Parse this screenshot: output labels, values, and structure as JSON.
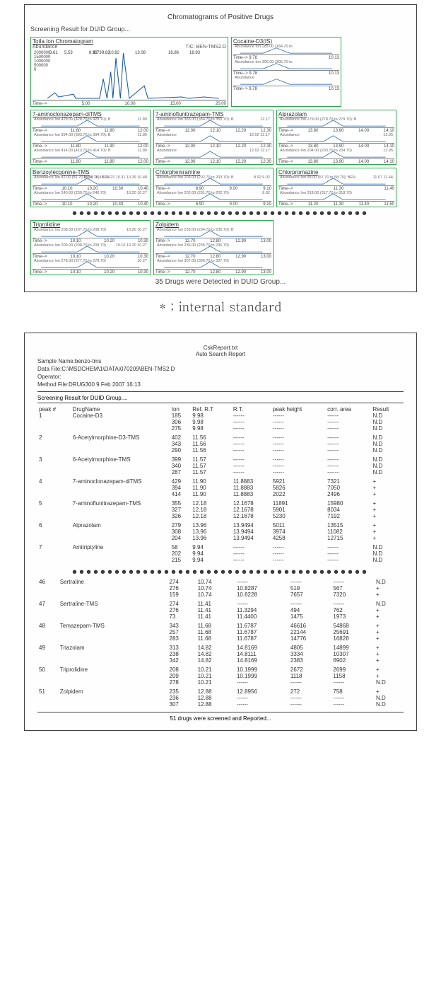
{
  "fig1": {
    "title": "Chromatograms of Positive Drugs",
    "subtitle": "Screening Result for DUID Group...",
    "tic": {
      "title": "Totla Ion Chromatogram",
      "trace_label": "TIC: BEN-TMS2.D",
      "ylab": "Abundance",
      "y_ticks": [
        "2000000",
        "1500000",
        "1000000",
        "500000",
        "0"
      ],
      "peak_labels": [
        "3.61",
        "5.53",
        "8.93",
        "9.73",
        "9.82",
        "10.82",
        "13.08",
        "16.86",
        "18.93"
      ],
      "x_ticks": [
        "5.00",
        "10.00",
        "15.00",
        "20.00"
      ],
      "timelab": "Time-->"
    },
    "is_panel": {
      "title": "Cocaine-D3(IS)",
      "rows": [
        {
          "label": "Abundance Ion 185.00 (184.70 to",
          "left": "9.78",
          "right": "10.13"
        },
        {
          "label": "Abundance Ion 306.00 (305.70 to",
          "left": "9.78",
          "right": "10.13"
        },
        {
          "label": "Abundance",
          "left": "9.78",
          "right": "10.13"
        }
      ],
      "timelab": "Time-->"
    },
    "compounds_row2": [
      {
        "title": "7-aminoclonazepam-diTMS",
        "rows": [
          {
            "label": "Abundance Ion 429.00 (428.70 to 429.70): B",
            "peak": "11.89",
            "ticks": [
              "11.80",
              "11.90",
              "12.00"
            ]
          },
          {
            "label": "Abundance Ion 394.00 (393.70 to 394.70): B",
            "peak": "11.89",
            "ticks": [
              "11.80",
              "11.90",
              "12.00"
            ]
          },
          {
            "label": "Abundance Ion 414.00 (413.70 to 414.70): B",
            "peak": "11.89",
            "ticks": [
              "11.80",
              "11.90",
              "12.00"
            ]
          }
        ]
      },
      {
        "title": "7-aminoflunitrazepam-TMS",
        "rows": [
          {
            "label": "Abundance Ion 355.00 (354.70 to 355.70): B",
            "peak": "12.17",
            "ticks": [
              "12.00",
              "12.10",
              "12.20",
              "12.30"
            ]
          },
          {
            "label": "Abundance",
            "peak": "12.02   12.17",
            "ticks": [
              "12.00",
              "12.10",
              "12.20",
              "12.30"
            ]
          },
          {
            "label": "Abundance",
            "peak": "12.02   12.17",
            "ticks": [
              "12.00",
              "12.10",
              "12.20",
              "12.30"
            ]
          }
        ]
      },
      {
        "title": "Alprazolam",
        "rows": [
          {
            "label": "Abundance Ion 279.00 (278.70 to 279.70): B",
            "peak": "",
            "ticks": [
              "13.80",
              "13.90",
              "14.00",
              "14.10"
            ]
          },
          {
            "label": "Abundance",
            "peak": "13.95",
            "ticks": [
              "13.80",
              "13.90",
              "14.00",
              "14.10"
            ]
          },
          {
            "label": "Abundance Ion 204.00 (203.70 to 204.70)",
            "peak": "13.95",
            "ticks": [
              "13.80",
              "13.90",
              "14.00",
              "14.10"
            ]
          }
        ]
      }
    ],
    "compounds_row3": [
      {
        "title": "Benzoylecgonine-TMS",
        "rows": [
          {
            "label": "Abundance Ion 82.00 (81.70 to 82.70): BEN",
            "peak": "10.08 10.17 10.23 10.31 10.39 10.48",
            "ticks": [
              "10.10",
              "10.20",
              "10.30",
              "10.40"
            ]
          },
          {
            "label": "Abundance Ion 240.00 (239.70 to 240.70)",
            "peak": "10.20 10.27",
            "ticks": [
              "10.10",
              "10.20",
              "10.30",
              "10.40"
            ]
          }
        ]
      },
      {
        "title": "Chlorpheniramine",
        "rows": [
          {
            "label": "Abundance Ion 203.00 (202.70 to 203.70): B",
            "peak": "8.92   9.02",
            "ticks": [
              "8.90",
              "9.00",
              "9.10"
            ]
          },
          {
            "label": "Abundance Ion 202.00 (201.70 to 202.70)",
            "peak": "8.92",
            "ticks": [
              "8.90",
              "9.00",
              "9.10"
            ]
          }
        ]
      },
      {
        "title": "Chlorpromazine",
        "rows": [
          {
            "label": "Abundance Ion 58.00 (57.70 to 58.70): BEN",
            "peak": "11.07   11.44",
            "ticks": [
              "11.30",
              "11.40"
            ]
          },
          {
            "label": "Abundance Ion 318.00 (317.70 to 318.70)",
            "peak": "",
            "ticks": [
              "11.20",
              "11.30",
              "11.40",
              "11.50"
            ]
          }
        ]
      }
    ],
    "compounds_row4": [
      {
        "title": "Triprolidine",
        "rows": [
          {
            "label": "Abundance Ion 208.00 (207.70 to 208.70)",
            "peak": "10.20 10.27",
            "ticks": [
              "10.10",
              "10.20",
              "10.30"
            ]
          },
          {
            "label": "Abundance Ion 209.00 (208.70 to 209.70)",
            "peak": "10.10 10.20 10.27",
            "ticks": [
              "10.10",
              "10.20",
              "10.30"
            ]
          },
          {
            "label": "Abundance Ion 278.00 (277.70 to 278.70)",
            "peak": "10.27",
            "ticks": [
              "10.10",
              "10.20",
              "10.30"
            ]
          }
        ]
      },
      {
        "title": "Zolpidem",
        "rows": [
          {
            "label": "Abundance Ion 235.00 (234.70 to 235.70): B",
            "peak": "",
            "ticks": [
              "12.70",
              "12.80",
              "12.90",
              "13.00"
            ]
          },
          {
            "label": "Abundance Ion 236.00 (235.70 to 236.70)",
            "peak": "",
            "ticks": [
              "12.70",
              "12.80",
              "12.90",
              "13.00"
            ]
          },
          {
            "label": "Abundance Ion 307.00 (306.70 to 307.70)",
            "peak": "",
            "ticks": [
              "12.70",
              "12.80",
              "12.90",
              "13.00"
            ]
          }
        ]
      }
    ],
    "footer": "35 Drugs were Detected in DUID Group..."
  },
  "note": "* ; internal standard",
  "fig2": {
    "header_right": [
      "CskReport.txt",
      "Auto Search Report"
    ],
    "meta": [
      "Sample Name:benzo-tms",
      "Data File:C:\\MSDCHEM\\1\\DATA\\070209\\BEN-TMS2.D",
      "Operator:",
      "Method File:DRUG300         9 Feb 2007    16:13"
    ],
    "screen_line": "Screening Result for DUID Group....",
    "cols": [
      "peak #",
      "DrugName",
      "Ion",
      "Ref. R.T",
      "R.T.",
      "peak height",
      "corr. area",
      "Result"
    ],
    "rows_top": [
      {
        "n": "1",
        "name": "Cocaine-D3",
        "ion": [
          "185",
          "306",
          "275"
        ],
        "ref": [
          "9.98",
          "9.98",
          "9.98"
        ],
        "rt": [
          "------",
          "------",
          "------"
        ],
        "h": [
          "------",
          "------",
          "------"
        ],
        "a": [
          "------",
          "------",
          "------"
        ],
        "r": [
          "N.D",
          "N.D",
          "N.D"
        ]
      },
      {
        "n": "2",
        "name": "6-Acetylmorphine-D3-TMS",
        "ion": [
          "402",
          "343",
          "290"
        ],
        "ref": [
          "11.56",
          "11.56",
          "11.56"
        ],
        "rt": [
          "------",
          "------",
          "------"
        ],
        "h": [
          "------",
          "------",
          "------"
        ],
        "a": [
          "------",
          "------",
          "------"
        ],
        "r": [
          "N.D",
          "N.D",
          "N.D"
        ]
      },
      {
        "n": "3",
        "name": "6-Acetylmorphine-TMS",
        "ion": [
          "399",
          "340",
          "287"
        ],
        "ref": [
          "11.57",
          "11.57",
          "11.57"
        ],
        "rt": [
          "------",
          "------",
          "------"
        ],
        "h": [
          "------",
          "------",
          "------"
        ],
        "a": [
          "------",
          "------",
          "------"
        ],
        "r": [
          "N.D",
          "N.D",
          "N.D"
        ]
      },
      {
        "n": "4",
        "name": "7-aminoclonazepam-diTMS",
        "ion": [
          "429",
          "394",
          "414"
        ],
        "ref": [
          "11.90",
          "11.90",
          "11.90"
        ],
        "rt": [
          "11.8883",
          "11.8883",
          "11.8883"
        ],
        "h": [
          "5921",
          "5826",
          "2022"
        ],
        "a": [
          "7321",
          "7050",
          "2496"
        ],
        "r": [
          "+",
          "+",
          "+"
        ]
      },
      {
        "n": "5",
        "name": "7-aminoflunitrazepam-TMS",
        "ion": [
          "355",
          "327",
          "326"
        ],
        "ref": [
          "12.18",
          "12.18",
          "12.18"
        ],
        "rt": [
          "12.1678",
          "12.1678",
          "12.1678"
        ],
        "h": [
          "11891",
          "5901",
          "5230"
        ],
        "a": [
          "15980",
          "8034",
          "7192"
        ],
        "r": [
          "+",
          "+",
          "+"
        ]
      },
      {
        "n": "6",
        "name": "Alprazolam",
        "ion": [
          "279",
          "308",
          "204"
        ],
        "ref": [
          "13.96",
          "13.96",
          "13.96"
        ],
        "rt": [
          "13.9494",
          "13.9494",
          "13.9494"
        ],
        "h": [
          "5011",
          "3974",
          "4258"
        ],
        "a": [
          "13515",
          "11082",
          "12715"
        ],
        "r": [
          "+",
          "+",
          "+"
        ]
      },
      {
        "n": "7",
        "name": "Amitriptyline",
        "ion": [
          "58",
          "202",
          "215"
        ],
        "ref": [
          "9.94",
          "9.94",
          "9.94"
        ],
        "rt": [
          "------",
          "------",
          "------"
        ],
        "h": [
          "------",
          "------",
          "------"
        ],
        "a": [
          "------",
          "------",
          "------"
        ],
        "r": [
          "N.D",
          "N.D",
          "N.D"
        ]
      }
    ],
    "rows_bottom": [
      {
        "n": "46",
        "name": "Sertraline",
        "ion": [
          "274",
          "276",
          "159"
        ],
        "ref": [
          "10.74",
          "10.74",
          "10.74"
        ],
        "rt": [
          "------",
          "10.8287",
          "10.8228"
        ],
        "h": [
          "------",
          "519",
          "7657"
        ],
        "a": [
          "------",
          "567",
          "7320"
        ],
        "r": [
          "N.D",
          "+",
          "+"
        ]
      },
      {
        "n": "47",
        "name": "Sertraline-TMS",
        "ion": [
          "274",
          "276",
          "73"
        ],
        "ref": [
          "11.41",
          "11.41",
          "11.41"
        ],
        "rt": [
          "------",
          "11.3294",
          "11.4400"
        ],
        "h": [
          "------",
          "494",
          "1475"
        ],
        "a": [
          "------",
          "762",
          "1973"
        ],
        "r": [
          "N.D",
          "+",
          "+"
        ]
      },
      {
        "n": "48",
        "name": "Temazepam-TMS",
        "ion": [
          "343",
          "257",
          "283"
        ],
        "ref": [
          "11.68",
          "11.68",
          "11.68"
        ],
        "rt": [
          "11.6787",
          "11.6787",
          "11.6787"
        ],
        "h": [
          "46616",
          "22144",
          "14776"
        ],
        "a": [
          "54868",
          "25691",
          "16828"
        ],
        "r": [
          "+",
          "+",
          "+"
        ]
      },
      {
        "n": "49",
        "name": "Triazolam",
        "ion": [
          "313",
          "238",
          "342"
        ],
        "ref": [
          "14.82",
          "14.82",
          "14.82"
        ],
        "rt": [
          "14.8169",
          "14.8111",
          "14.8169"
        ],
        "h": [
          "4805",
          "3334",
          "2383"
        ],
        "a": [
          "14899",
          "10307",
          "6902"
        ],
        "r": [
          "+",
          "+",
          "+"
        ]
      },
      {
        "n": "50",
        "name": "Triprolidine",
        "ion": [
          "208",
          "209",
          "278"
        ],
        "ref": [
          "10.21",
          "10.21",
          "10.21"
        ],
        "rt": [
          "10.1999",
          "10.1999",
          "------"
        ],
        "h": [
          "2672",
          "1118",
          "------"
        ],
        "a": [
          "2699",
          "1158",
          "------"
        ],
        "r": [
          "+",
          "+",
          "N.D"
        ]
      },
      {
        "n": "51",
        "name": "Zolpidem",
        "ion": [
          "235",
          "236",
          "307"
        ],
        "ref": [
          "12.88",
          "12.88",
          "12.88"
        ],
        "rt": [
          "12.8956",
          "------",
          "------"
        ],
        "h": [
          "272",
          "------",
          "------"
        ],
        "a": [
          "758",
          "------",
          "------"
        ],
        "r": [
          "+",
          "N.D",
          "N.D"
        ]
      }
    ],
    "footer": "51 drugs were screened and Reported..."
  },
  "chart_data": {
    "type": "line",
    "title": "Totla Ion Chromatogram TIC: BEN-TMS2.D",
    "xlabel": "Time",
    "ylabel": "Abundance",
    "x": [
      3.61,
      5.53,
      8.93,
      9.73,
      9.82,
      10.82,
      13.08,
      16.86,
      18.93
    ],
    "values": [
      120000,
      150000,
      600000,
      780000,
      1800000,
      2200000,
      560000,
      80000,
      90000
    ],
    "ylim": [
      0,
      2200000
    ],
    "xlim": [
      3,
      22
    ]
  }
}
